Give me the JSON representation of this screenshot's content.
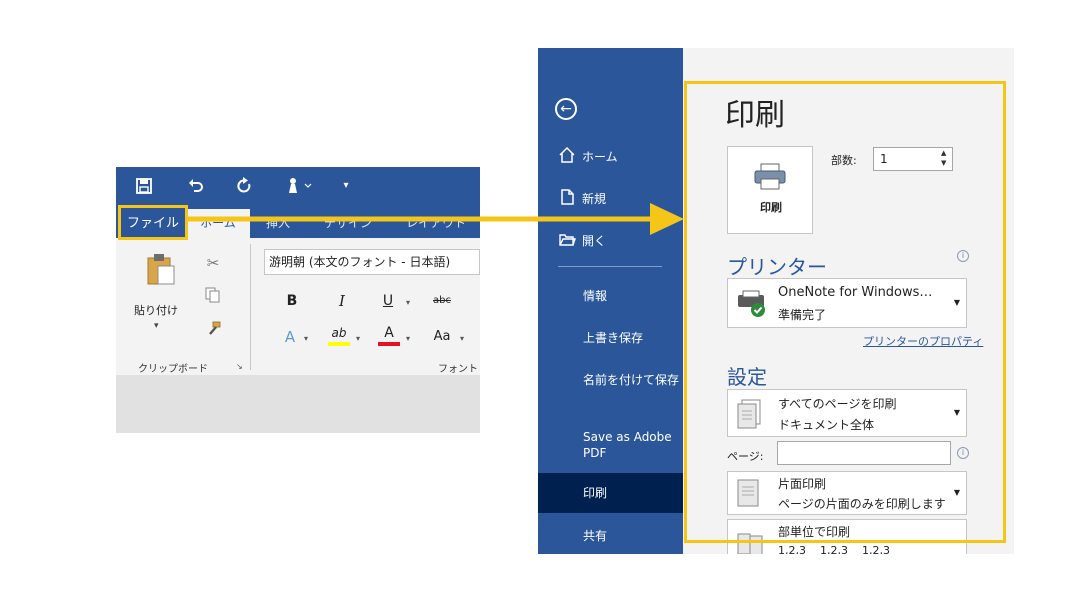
{
  "ribbon": {
    "qat": {
      "save_icon": "save-icon",
      "undo_icon": "undo-icon",
      "redo_icon": "redo-icon",
      "touch_icon": "touch-mode-icon",
      "customize_icon": "customize-qat-icon"
    },
    "tabs": {
      "file": "ファイル",
      "home": "ホーム",
      "insert": "挿入",
      "design": "デザイン",
      "layout": "レイアウト"
    },
    "clipboard": {
      "paste_label": "貼り付け",
      "group_label": "クリップボード"
    },
    "font": {
      "font_name": "游明朝 (本文のフォント - 日本語)",
      "bold": "B",
      "italic": "I",
      "underline": "U",
      "strikethrough": "abc",
      "text_effects": "A",
      "highlight": "ab",
      "font_color": "A",
      "change_case": "Aa",
      "group_label": "フォント"
    },
    "colors": {
      "ribbon_blue": "#2b579a",
      "highlight_yellow": "#f5c518",
      "font_color_red": "#e81123"
    }
  },
  "backstage": {
    "nav": {
      "home": "ホーム",
      "new": "新規",
      "open": "開く",
      "info": "情報",
      "save": "上書き保存",
      "save_as": "名前を付けて保存",
      "save_as_pdf": "Save as Adobe PDF",
      "print": "印刷",
      "share": "共有"
    },
    "print": {
      "title": "印刷",
      "button_label": "印刷",
      "copies_label": "部数:",
      "copies_value": "1"
    },
    "printer": {
      "section_title": "プリンター",
      "name": "OneNote for Windows…",
      "status": "準備完了",
      "properties_link": "プリンターのプロパティ"
    },
    "settings": {
      "section_title": "設定",
      "range_line1": "すべてのページを印刷",
      "range_line2": "ドキュメント全体",
      "pages_label": "ページ:",
      "pages_value": "",
      "sides_line1": "片面印刷",
      "sides_line2": "ページの片面のみを印刷します",
      "collate_line1": "部単位で印刷",
      "collate_line2": "1,2,3    1,2,3    1,2,3"
    },
    "colors": {
      "sidebar_blue": "#2b579a",
      "active_nav": "#002050",
      "highlight_yellow": "#f5c518"
    }
  }
}
